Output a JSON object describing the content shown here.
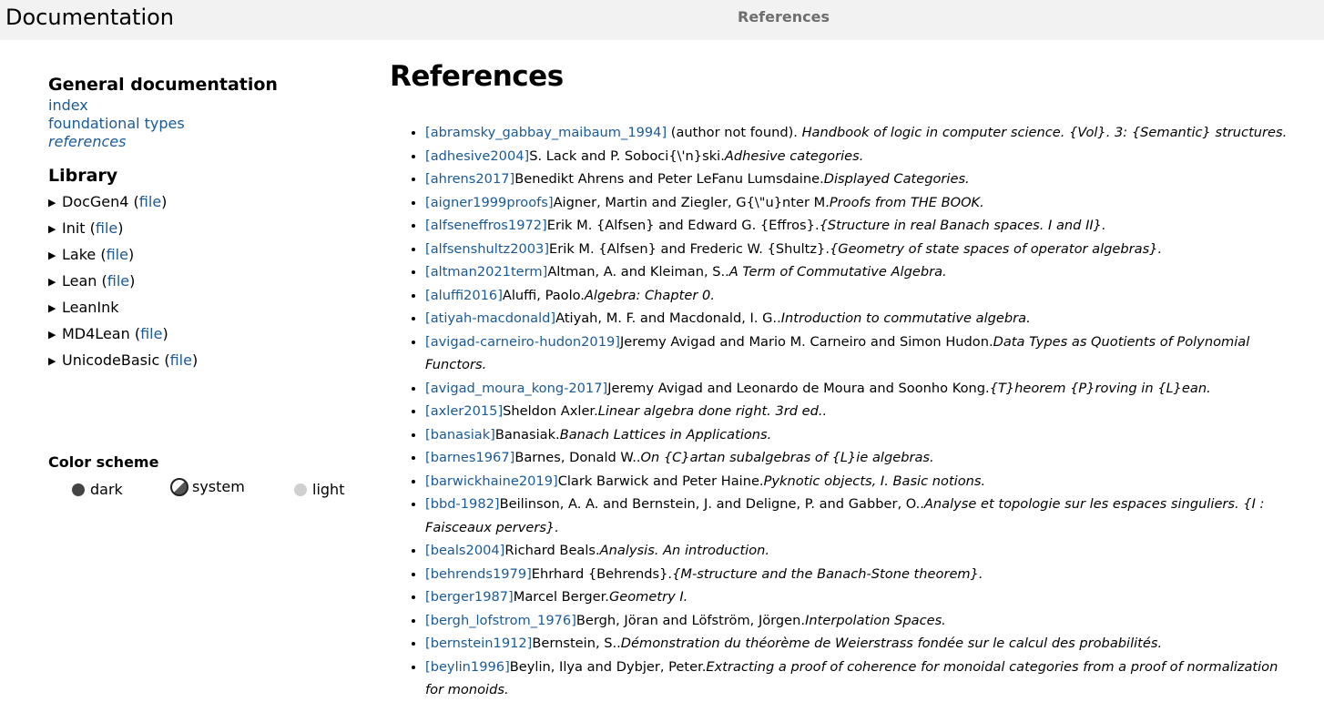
{
  "header": {
    "title": "Documentation",
    "page": "References"
  },
  "nav": {
    "general_heading": "General documentation",
    "general_links": [
      {
        "label": "index"
      },
      {
        "label": "foundational types"
      },
      {
        "label": "references"
      }
    ],
    "library_heading": "Library",
    "library": [
      {
        "name": "DocGen4",
        "file": "file"
      },
      {
        "name": "Init",
        "file": "file"
      },
      {
        "name": "Lake",
        "file": "file"
      },
      {
        "name": "Lean",
        "file": "file"
      },
      {
        "name": "LeanInk",
        "file": ""
      },
      {
        "name": "MD4Lean",
        "file": "file"
      },
      {
        "name": "UnicodeBasic",
        "file": "file"
      }
    ]
  },
  "color_scheme": {
    "heading": "Color scheme",
    "options": [
      "dark",
      "system",
      "light"
    ],
    "selected": "system"
  },
  "main": {
    "title": "References",
    "references": [
      {
        "key": "[abramsky_gabbay_maibaum_1994]",
        "authors": " (author not found). ",
        "title": "Handbook of logic in computer science. {Vol}. 3: {Semantic} structures."
      },
      {
        "key": "[adhesive2004]",
        "authors": "S. Lack and P. Soboci{\\'n}ski.",
        "title": "Adhesive categories."
      },
      {
        "key": "[ahrens2017]",
        "authors": "Benedikt Ahrens and Peter LeFanu Lumsdaine.",
        "title": "Displayed Categories."
      },
      {
        "key": "[aigner1999proofs]",
        "authors": "Aigner, Martin and Ziegler, G{\\\"u}nter M.",
        "title": "Proofs from THE BOOK."
      },
      {
        "key": "[alfseneffros1972]",
        "authors": "Erik M. {Alfsen} and Edward G. {Effros}.",
        "title": "{Structure in real Banach spaces. I and II}."
      },
      {
        "key": "[alfsenshultz2003]",
        "authors": "Erik M. {Alfsen} and Frederic W. {Shultz}.",
        "title": "{Geometry of state spaces of operator algebras}."
      },
      {
        "key": "[altman2021term]",
        "authors": "Altman, A. and Kleiman, S..",
        "title": "A Term of Commutative Algebra."
      },
      {
        "key": "[aluffi2016]",
        "authors": "Aluffi, Paolo.",
        "title": "Algebra: Chapter 0."
      },
      {
        "key": "[atiyah-macdonald]",
        "authors": "Atiyah, M. F. and Macdonald, I. G..",
        "title": "Introduction to commutative algebra."
      },
      {
        "key": "[avigad-carneiro-hudon2019]",
        "authors": "Jeremy Avigad and Mario M. Carneiro and Simon Hudon.",
        "title": "Data Types as Quotients of Polynomial Functors."
      },
      {
        "key": "[avigad_moura_kong-2017]",
        "authors": "Jeremy Avigad and Leonardo de Moura and Soonho Kong.",
        "title": "{T}heorem {P}roving in {L}ean."
      },
      {
        "key": "[axler2015]",
        "authors": "Sheldon Axler.",
        "title": "Linear algebra done right. 3rd ed.."
      },
      {
        "key": "[banasiak]",
        "authors": "Banasiak.",
        "title": "Banach Lattices in Applications."
      },
      {
        "key": "[barnes1967]",
        "authors": "Barnes, Donald W..",
        "title": "On {C}artan subalgebras of {L}ie algebras."
      },
      {
        "key": "[barwickhaine2019]",
        "authors": "Clark Barwick and Peter Haine.",
        "title": "Pyknotic objects, I. Basic notions."
      },
      {
        "key": "[bbd-1982]",
        "authors": "Beilinson, A. A. and Bernstein, J. and Deligne, P. and Gabber, O..",
        "title": "Analyse et topologie sur les espaces singuliers. {I : Faisceaux pervers}."
      },
      {
        "key": "[beals2004]",
        "authors": "Richard Beals.",
        "title": "Analysis. An introduction."
      },
      {
        "key": "[behrends1979]",
        "authors": "Ehrhard {Behrends}.",
        "title": "{M-structure and the Banach-Stone theorem}."
      },
      {
        "key": "[berger1987]",
        "authors": "Marcel Berger.",
        "title": "Geometry I."
      },
      {
        "key": "[bergh_lofstrom_1976]",
        "authors": "Bergh, Jöran and Löfström, Jörgen.",
        "title": "Interpolation Spaces."
      },
      {
        "key": "[bernstein1912]",
        "authors": "Bernstein, S..",
        "title": "Démonstration du théorème de Weierstrass fondée sur le calcul des probabilités."
      },
      {
        "key": "[beylin1996]",
        "authors": "Beylin, Ilya and Dybjer, Peter.",
        "title": "Extracting a proof of coherence for monoidal categories from a proof of normalization for monoids."
      }
    ]
  }
}
